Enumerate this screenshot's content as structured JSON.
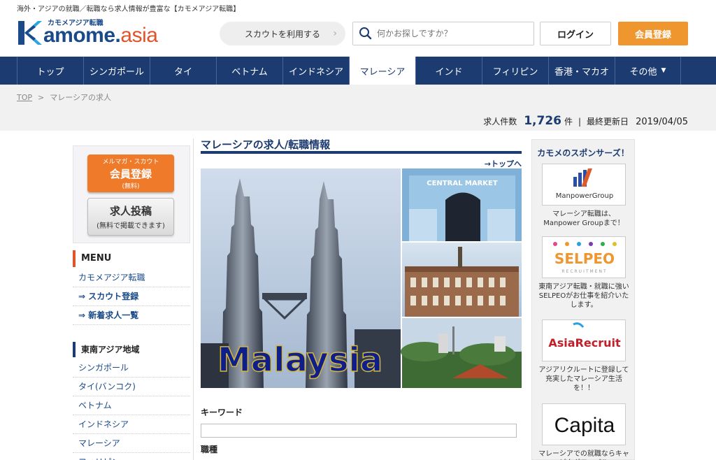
{
  "header": {
    "tagline": "海外・アジアの就職／転職なら求人情報が豊富な【カモメアジア転職】",
    "logo_sub": "カモメアジア転職",
    "logo_main": "amome.",
    "logo_asia": "asia",
    "scout_label": "スカウトを利用する",
    "search_placeholder": "何かお探しですか？",
    "login_label": "ログイン",
    "register_label": "会員登録"
  },
  "nav": {
    "items": [
      {
        "label": "トップ"
      },
      {
        "label": "シンガポール"
      },
      {
        "label": "タイ"
      },
      {
        "label": "ベトナム"
      },
      {
        "label": "インドネシア"
      },
      {
        "label": "マレーシア"
      },
      {
        "label": "インド"
      },
      {
        "label": "フィリピン"
      },
      {
        "label": "香港・マカオ"
      },
      {
        "label": "その他"
      }
    ],
    "active_index": 5
  },
  "breadcrumb": {
    "top": "TOP",
    "sep": ">",
    "current": "マレーシアの求人"
  },
  "stats": {
    "count_label": "求人件数",
    "count": "1,726",
    "count_unit": "件",
    "bar": "|",
    "updated_label": "最終更新日",
    "updated_date": "2019/04/05"
  },
  "left": {
    "member_btn": {
      "line1": "メルマガ・スカウト",
      "line2": "会員登録",
      "line3": "(無料)"
    },
    "post_btn": {
      "line1": "求人投稿",
      "line2": "(無料で掲載できます)"
    },
    "menu_head": "MENU",
    "menu": [
      {
        "label": "カモメアジア転職"
      },
      {
        "label": "⇒ スカウト登録"
      },
      {
        "label": "⇒ 新着求人一覧"
      }
    ],
    "region_head": "東南アジア地域",
    "regions": [
      {
        "label": "シンガポール"
      },
      {
        "label": "タイ(バンコク)"
      },
      {
        "label": "ベトナム"
      },
      {
        "label": "インドネシア"
      },
      {
        "label": "マレーシア"
      },
      {
        "label": "フィリピン"
      }
    ]
  },
  "center": {
    "title": "マレーシアの求人/転職情報",
    "to_top": "→トップへ",
    "collage_word": "Malaysia",
    "market_sign": "CENTRAL MARKET",
    "keyword_label": "キーワード",
    "job_label": "職種"
  },
  "right": {
    "head": "カモメのスポンサーズ！",
    "sponsors": [
      {
        "name": "ManpowerGroup",
        "desc": "マレーシア転職は、Manpower Groupまで！"
      },
      {
        "name": "SELPEO",
        "sub": "RECRUITMENT",
        "desc": "東南アジア転職・就職に強いSELPEOがお仕事を紹介いたします。"
      },
      {
        "name": "AsiaRecruit",
        "desc": "アジアリクルートに登録して充実したマレーシア生活を！！"
      },
      {
        "name": "Capita",
        "desc": "マレーシアでの就職ならキャピタグローバル"
      }
    ]
  },
  "colors": {
    "nav_bg": "#1c3b70",
    "accent_orange": "#f0962f",
    "logo_blue": "#1a4a8a",
    "logo_red": "#e0542a"
  }
}
